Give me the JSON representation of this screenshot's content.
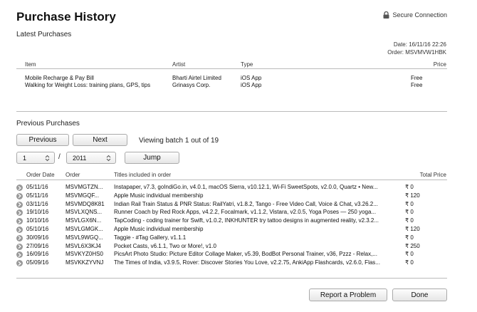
{
  "header": {
    "title": "Purchase History",
    "secure_label": "Secure Connection"
  },
  "latest": {
    "heading": "Latest Purchases",
    "date_label": "Date:",
    "date_value": "16/11/16 22:26",
    "order_label": "Order:",
    "order_value": "MSVMVW1HBK",
    "columns": {
      "item": "Item",
      "artist": "Artist",
      "type": "Type",
      "price": "Price"
    },
    "items": [
      {
        "item": "Mobile Recharge & Pay Bill",
        "artist": "Bharti Airtel Limited",
        "type": "iOS App",
        "price": "Free"
      },
      {
        "item": "Walking for Weight Loss: training plans, GPS, tips",
        "artist": "Grinasys Corp.",
        "type": "iOS App",
        "price": "Free"
      }
    ]
  },
  "previous": {
    "heading": "Previous Purchases",
    "previous_label": "Previous",
    "next_label": "Next",
    "batch_text": "Viewing batch 1 out of 19",
    "month_value": "1",
    "slash": "/",
    "year_value": "2011",
    "jump_label": "Jump",
    "columns": {
      "date": "Order Date",
      "order": "Order",
      "titles": "Titles included in order",
      "total": "Total Price"
    },
    "rows": [
      {
        "date": "05/11/16",
        "order": "MSVMGTZN...",
        "titles": "Instapaper, v7.3, goIndiGo.in, v4.0.1, macOS Sierra, v10.12.1, Wi-Fi SweetSpots, v2.0.0, Quartz • New...",
        "total": "₹ 0"
      },
      {
        "date": "05/11/16",
        "order": "MSVMGQF...",
        "titles": "Apple Music individual membership",
        "total": "₹ 120"
      },
      {
        "date": "03/11/16",
        "order": "MSVMDQ8K81",
        "titles": "Indian Rail Train Status & PNR Status: RailYatri, v1.8.2, Tango - Free Video Call, Voice & Chat, v3.26.2...",
        "total": "₹ 0"
      },
      {
        "date": "19/10/16",
        "order": "MSVLXQNS...",
        "titles": "Runner Coach by Red Rock Apps, v4.2.2, Focalmark, v1.1.2, Vistara, v2.0.5, Yoga Poses — 250 yoga...",
        "total": "₹ 0"
      },
      {
        "date": "10/10/16",
        "order": "MSVLGX6N...",
        "titles": "TapCoding - coding trainer for Swift, v1.0.2, INKHUNTER try tattoo designs in augmented reality, v2.3.2...",
        "total": "₹ 0"
      },
      {
        "date": "05/10/16",
        "order": "MSVLGMGK...",
        "titles": "Apple Music individual membership",
        "total": "₹ 120"
      },
      {
        "date": "30/09/16",
        "order": "MSVL9WGQ...",
        "titles": "Taggie - #Tag Gallery, v1.1.1",
        "total": "₹ 0"
      },
      {
        "date": "27/09/16",
        "order": "MSVL6X3KJ4",
        "titles": "Pocket Casts, v6.1.1, Two or More!, v1.0",
        "total": "₹ 250"
      },
      {
        "date": "16/09/16",
        "order": "MSVKYZ0HS0",
        "titles": "PicsArt Photo Studio: Picture Editor Collage Maker, v5.39, BodBot Personal Trainer, v36, Pzzz - Relax,...",
        "total": "₹ 0"
      },
      {
        "date": "05/09/16",
        "order": "MSVKKZYVNJ",
        "titles": "The Times of India, v3.9.5, Rover: Discover Stories You Love, v2.2.75, AnkiApp Flashcards, v2.6.0, Flas...",
        "total": "₹ 0"
      }
    ]
  },
  "footer": {
    "report_label": "Report a Problem",
    "done_label": "Done"
  }
}
